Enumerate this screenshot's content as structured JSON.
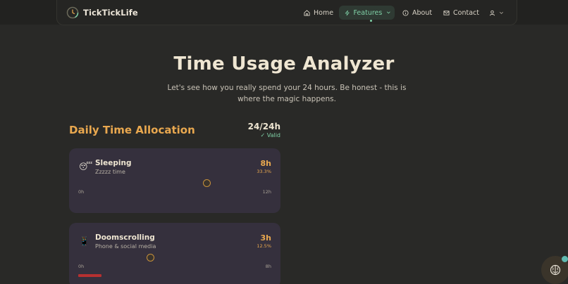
{
  "nav": {
    "brand": "TickTickLife",
    "items": [
      {
        "label": "Home",
        "icon": "home-icon"
      },
      {
        "label": "Features",
        "icon": "zap-icon",
        "active": true
      },
      {
        "label": "About",
        "icon": "info-icon"
      },
      {
        "label": "Contact",
        "icon": "mail-icon"
      }
    ],
    "user_icon": "user-icon"
  },
  "hero": {
    "title": "Time Usage Analyzer",
    "subtitle": "Let's see how you really spend your 24 hours. Be honest - this is where the magic happens."
  },
  "allocation": {
    "title": "Daily Time Allocation",
    "total": "24/24h",
    "status": "✓ Valid",
    "activities": [
      {
        "emoji": "😴",
        "name": "Sleeping",
        "description": "Zzzzz time",
        "hours": "8h",
        "percent": "33.3%",
        "min_label": "0h",
        "max_label": "12h",
        "value": 8,
        "max": 12
      },
      {
        "emoji": "📱",
        "name": "Doomscrolling",
        "description": "Phone & social media",
        "hours": "3h",
        "percent": "12.5%",
        "min_label": "0h",
        "max_label": "8h",
        "value": 3,
        "max": 8
      }
    ]
  },
  "colors": {
    "accent": "#e9a84f",
    "active": "#7fd0a6",
    "background": "#292927",
    "card": "#35303d"
  }
}
